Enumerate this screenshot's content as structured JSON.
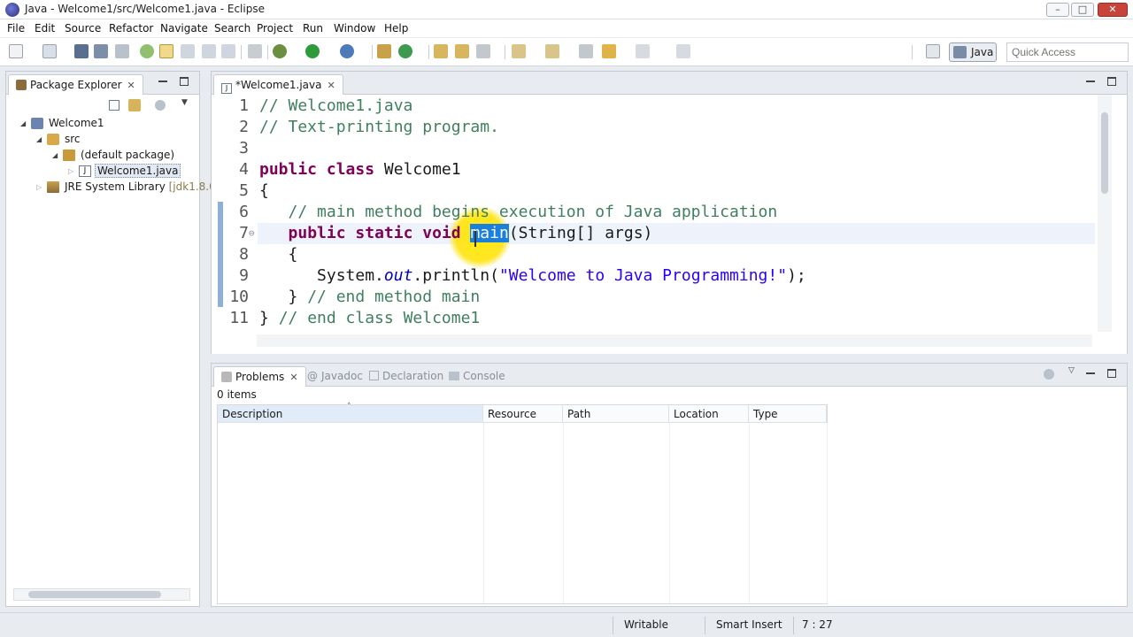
{
  "window": {
    "title": "Java - Welcome1/src/Welcome1.java - Eclipse"
  },
  "menu": [
    "File",
    "Edit",
    "Source",
    "Refactor",
    "Navigate",
    "Search",
    "Project",
    "Run",
    "Window",
    "Help"
  ],
  "perspective": {
    "label": "Java"
  },
  "quick_access": {
    "placeholder": "Quick Access"
  },
  "package_explorer": {
    "tab": "Package Explorer",
    "tree": [
      {
        "label": "Welcome1",
        "kind": "project",
        "depth": 0,
        "expanded": true
      },
      {
        "label": "src",
        "kind": "source-folder",
        "depth": 1,
        "expanded": true
      },
      {
        "label": "(default package)",
        "kind": "package",
        "depth": 2,
        "expanded": true
      },
      {
        "label": "Welcome1.java",
        "kind": "java-file",
        "depth": 3,
        "expanded": false,
        "selected": true
      },
      {
        "label": "JRE System Library",
        "decoration": "[jdk1.8.0",
        "kind": "library",
        "depth": 1,
        "expanded": false
      }
    ]
  },
  "editor": {
    "tab": "*Welcome1.java",
    "current_line": 7,
    "lines": [
      {
        "num": "1",
        "text": "// Welcome1.java"
      },
      {
        "num": "2",
        "text": "// Text-printing program."
      },
      {
        "num": "3",
        "text": ""
      },
      {
        "num": "4",
        "text": "public class Welcome1"
      },
      {
        "num": "5",
        "text": "{"
      },
      {
        "num": "6",
        "text": "   // main method begins execution of Java application"
      },
      {
        "num": "7",
        "text": "   public static void main(String[] args)"
      },
      {
        "num": "8",
        "text": "   {"
      },
      {
        "num": "9",
        "text": "      System.out.println(\"Welcome to Java Programming!\");"
      },
      {
        "num": "10",
        "text": "   } // end method main"
      },
      {
        "num": "11",
        "text": "} // end class Welcome1"
      }
    ]
  },
  "problems_view": {
    "tabs": [
      "Problems",
      "Javadoc",
      "Declaration",
      "Console"
    ],
    "items_count": "0 items",
    "columns": [
      "Description",
      "Resource",
      "Path",
      "Location",
      "Type"
    ]
  },
  "status_bar": {
    "mode": "Writable",
    "insert": "Smart Insert",
    "position": "7 : 27"
  },
  "colors": {
    "keyword": "#7f0055",
    "comment": "#3f7f5f",
    "string": "#2a00ff",
    "selection": "#1b7fdc",
    "highlight": "#ffe200"
  }
}
